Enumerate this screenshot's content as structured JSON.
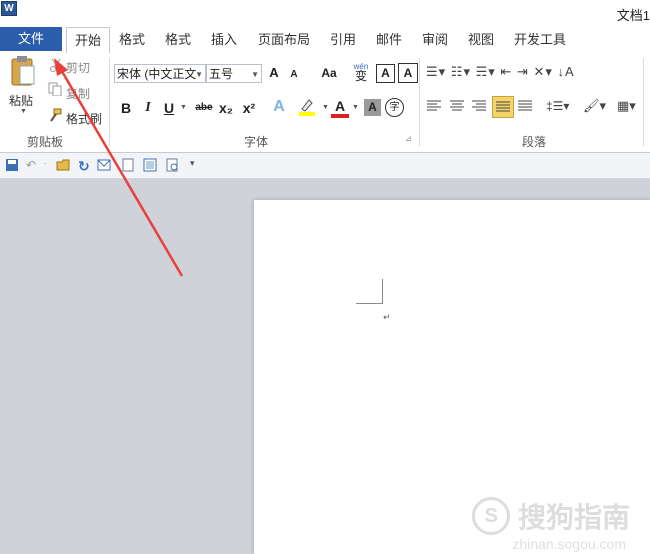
{
  "titlebar": {
    "app_icon": "W",
    "doc_title": "文档1"
  },
  "tabs": {
    "file": "文件",
    "items": [
      "开始",
      "格式",
      "格式",
      "插入",
      "页面布局",
      "引用",
      "邮件",
      "审阅",
      "视图",
      "开发工具"
    ]
  },
  "ribbon": {
    "clipboard": {
      "paste": "粘贴",
      "cut": "剪切",
      "copy": "复制",
      "format_painter": "格式刷",
      "group_label": "剪贴板"
    },
    "font": {
      "font_name": "宋体 (中文正文",
      "font_size": "五号",
      "change_case": "Aa",
      "group_label": "字体",
      "bold": "B",
      "italic": "I",
      "underline": "U",
      "strike": "abe",
      "subscript": "x₂",
      "superscript": "x²",
      "grow": "A",
      "shrink": "A",
      "wen": "wén",
      "pinyin_char": "变",
      "border_char": "A",
      "char_shade": "A",
      "enclose": "字"
    },
    "paragraph": {
      "group_label": "段落"
    }
  },
  "watermark": {
    "text": "搜狗指南",
    "url": "zhinan.sogou.com"
  },
  "colors": {
    "file_tab": "#2a5dab",
    "arrow": "#e8403a",
    "highlight": "#f5d36b"
  }
}
